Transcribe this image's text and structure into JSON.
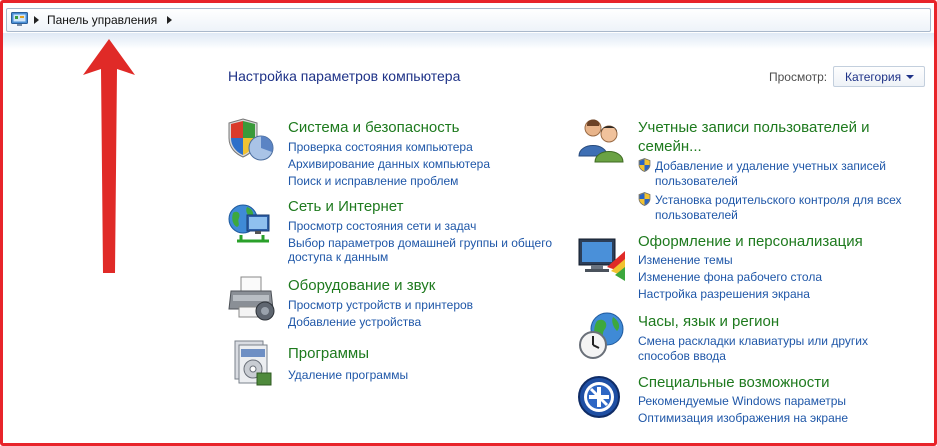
{
  "address_bar": {
    "path": "Панель управления"
  },
  "main": {
    "heading": "Настройка параметров компьютера",
    "view_label": "Просмотр:",
    "view_value": "Категория"
  },
  "categories_left": [
    {
      "title": "Система и безопасность",
      "icon": "shield-chart-icon",
      "links": [
        "Проверка состояния компьютера",
        "Архивирование данных компьютера",
        "Поиск и исправление проблем"
      ]
    },
    {
      "title": "Сеть и Интернет",
      "icon": "globe-network-icon",
      "links": [
        "Просмотр состояния сети и задач",
        "Выбор параметров домашней группы и общего",
        "доступа к данным"
      ]
    },
    {
      "title": "Оборудование и звук",
      "icon": "printer-icon",
      "links": [
        "Просмотр устройств и принтеров",
        "Добавление устройства"
      ]
    },
    {
      "title": "Программы",
      "icon": "programs-box-icon",
      "links": [
        "Удаление программы"
      ]
    }
  ],
  "categories_right": [
    {
      "title_line1": "Учетные записи пользователей и",
      "title_line2": "семейн...",
      "icon": "users-icon",
      "links": [
        "Добавление и удаление учетных записей",
        "пользователей",
        "Установка родительского контроля для всех",
        "пользователей"
      ]
    },
    {
      "title": "Оформление и персонализация",
      "icon": "monitor-paint-icon",
      "links": [
        "Изменение темы",
        "Изменение фона рабочего стола",
        "Настройка разрешения экрана"
      ]
    },
    {
      "title": "Часы, язык и регион",
      "icon": "clock-globe-icon",
      "links": [
        "Смена раскладки клавиатуры или других",
        "способов ввода"
      ]
    },
    {
      "title": "Специальные возможности",
      "icon": "accessibility-icon",
      "links": [
        "Рекомендуемые Windows параметры",
        "Оптимизация изображения на экране"
      ]
    }
  ],
  "colors": {
    "frame_border": "#e8242a",
    "category_title": "#1e7a1e",
    "link": "#1f57a8",
    "heading": "#1e3287",
    "annotation_arrow": "#e02a27"
  }
}
